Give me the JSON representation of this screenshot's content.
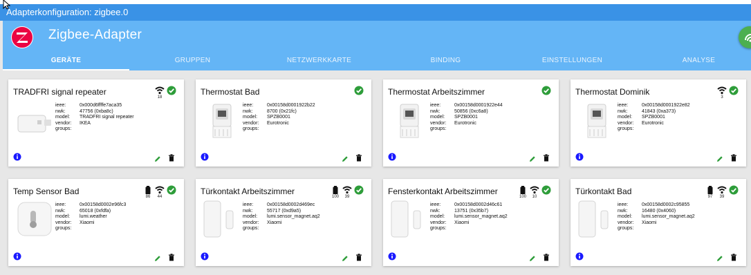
{
  "window": {
    "title": "Adapterkonfiguration: zigbee.0"
  },
  "header": {
    "title": "Zigbee-Adapter"
  },
  "tabs": [
    "GERÄTE",
    "GRUPPEN",
    "NETZWERKKARTE",
    "BINDING",
    "EINSTELLUNGEN",
    "ANALYSE"
  ],
  "labels": {
    "ieee": "ieee:",
    "nwk": "nwk:",
    "model": "model:",
    "vendor": "vendor:",
    "groups": "groups:"
  },
  "colors": {
    "titlebar": "#3a92e6",
    "header": "#64b5f6",
    "ok": "#2e9d3a",
    "info": "#1a1aff"
  },
  "devices": [
    {
      "name": "TRADFRI signal repeater",
      "ieee": "0x000d6ffffe7aca35",
      "nwk": "47756 (0xba8c)",
      "model": "TRADFRI signal repeater",
      "vendor": "IKEA",
      "groups": "",
      "link": "18",
      "image": "repeater"
    },
    {
      "name": "Thermostat Bad",
      "ieee": "0x00158d0001922b22",
      "nwk": "8700 (0x21fc)",
      "model": "SPZB0001",
      "vendor": "Eurotronic",
      "groups": "",
      "image": "thermostat"
    },
    {
      "name": "Thermostat Arbeitszimmer",
      "ieee": "0x00158d0001922e44",
      "nwk": "50856 (0xc6a8)",
      "model": "SPZB0001",
      "vendor": "Eurotronic",
      "groups": "",
      "image": "thermostat"
    },
    {
      "name": "Thermostat Dominik",
      "ieee": "0x00158d0001922e82",
      "nwk": "41843 (0xa373)",
      "model": "SPZB0001",
      "vendor": "Eurotronic",
      "groups": "",
      "link": "3",
      "image": "thermostat"
    },
    {
      "name": "Temp Sensor Bad",
      "ieee": "0x00158d0002e96fc3",
      "nwk": "65018 (0xfdfa)",
      "model": "lumi.weather",
      "vendor": "Xiaomi",
      "groups": "",
      "battery": "86",
      "link": "44",
      "image": "weather"
    },
    {
      "name": "Türkontakt Arbeitszimmer",
      "ieee": "0x00158d0002d469ec",
      "nwk": "55717 (0xd9a5)",
      "model": "lumi.sensor_magnet.aq2",
      "vendor": "Xiaomi",
      "groups": "",
      "battery": "100",
      "link": "39",
      "image": "magnet"
    },
    {
      "name": "Fensterkontakt Arbeitszimmer",
      "ieee": "0x00158d0002d46c61",
      "nwk": "13751 (0x35b7)",
      "model": "lumi.sensor_magnet.aq2",
      "vendor": "Xiaomi",
      "groups": "",
      "battery": "100",
      "link": "10",
      "image": "magnet"
    },
    {
      "name": "Türkontakt Bad",
      "ieee": "0x00158d0002c95855",
      "nwk": "16480 (0x4060)",
      "model": "lumi.sensor_magnet.aq2",
      "vendor": "Xiaomi",
      "groups": "",
      "battery": "97",
      "link": "39",
      "image": "magnet"
    }
  ]
}
